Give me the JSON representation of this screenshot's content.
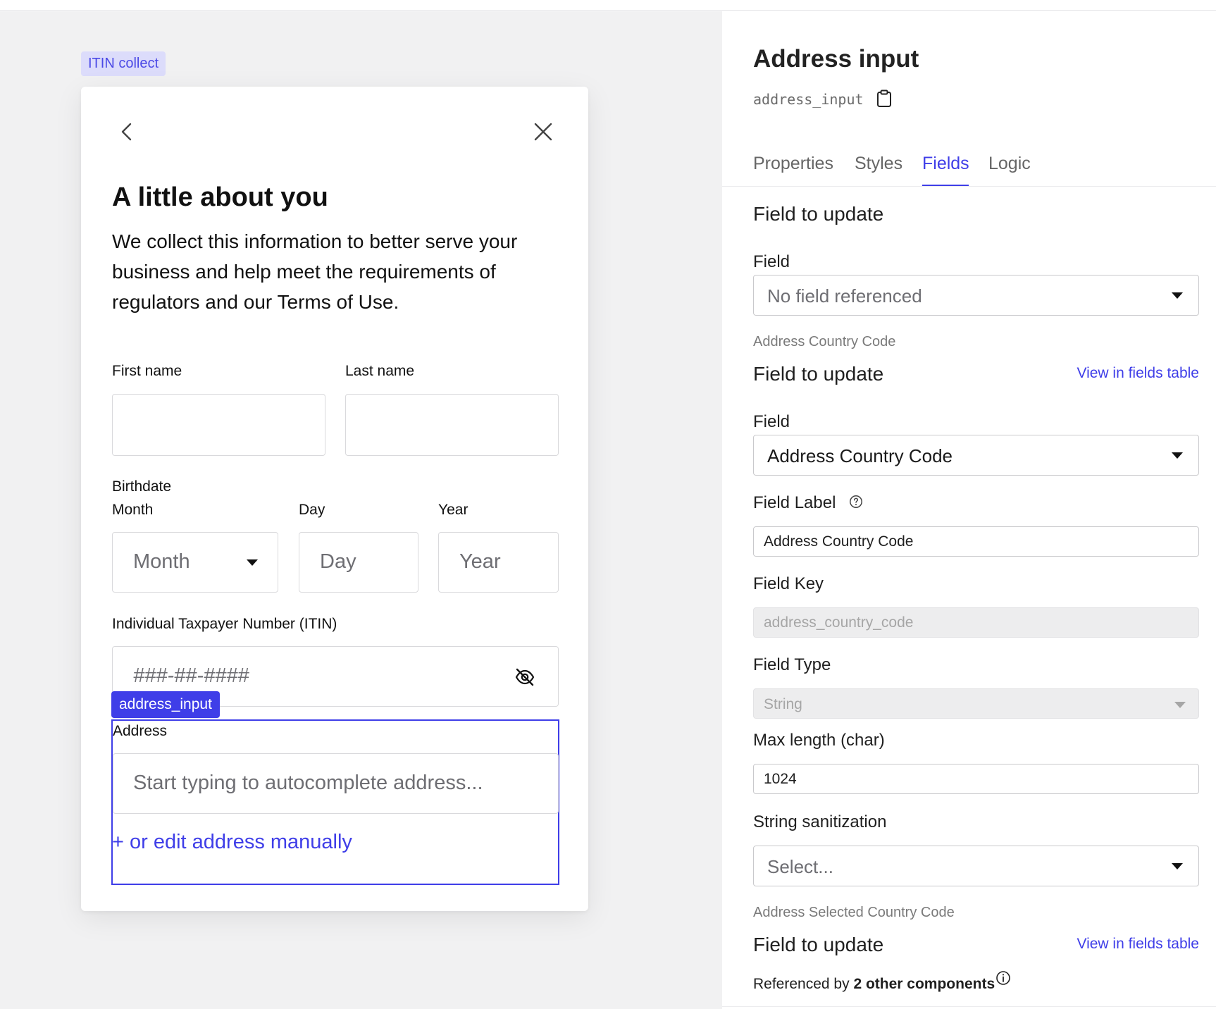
{
  "canvas": {
    "component_label": "ITIN collect",
    "form": {
      "title": "A little about you",
      "intro": "We collect this information to better serve your business and help meet the requirements of regulators and our Terms of Use.",
      "first_name_label": "First name",
      "last_name_label": "Last name",
      "birthdate_label": "Birthdate",
      "month_label": "Month",
      "day_label": "Day",
      "year_label": "Year",
      "month_placeholder": "Month",
      "day_placeholder": "Day",
      "year_placeholder": "Year",
      "itin_label": "Individual Taxpayer Number (ITIN)",
      "itin_placeholder": "###-##-####",
      "selected_tag": "address_input",
      "address_label": "Address",
      "address_placeholder": "Start typing to autocomplete address...",
      "address_manual_link": "+ or edit address manually"
    }
  },
  "panel": {
    "title": "Address input",
    "key": "address_input",
    "tabs": [
      {
        "label": "Properties",
        "active": false
      },
      {
        "label": "Styles",
        "active": false
      },
      {
        "label": "Fields",
        "active": true
      },
      {
        "label": "Logic",
        "active": false
      }
    ],
    "section1": {
      "heading": "Field to update",
      "field_label": "Field",
      "field_value": "No field referenced"
    },
    "section2": {
      "caption": "Address Country Code",
      "heading": "Field to update",
      "link": "View in fields table",
      "field_label": "Field",
      "field_value": "Address Country Code",
      "field_label_label": "Field Label",
      "field_label_value": "Address Country Code",
      "field_key_label": "Field Key",
      "field_key_value": "address_country_code",
      "field_type_label": "Field Type",
      "field_type_value": "String",
      "max_length_label": "Max length (char)",
      "max_length_value": "1024",
      "sanitization_label": "String sanitization",
      "sanitization_placeholder": "Select..."
    },
    "section3": {
      "caption": "Address Selected Country Code",
      "heading": "Field to update",
      "link": "View in fields table"
    },
    "referenced": {
      "prefix": "Referenced by",
      "count_text": "2 other components"
    }
  },
  "colors": {
    "accent": "#3f3ee8",
    "canvas_bg": "#f1f1f2",
    "label_chip_bg": "#dcdcfb"
  },
  "icons": [
    "chevron-left-icon",
    "close-icon",
    "chevron-down-icon",
    "eye-off-icon",
    "clipboard-icon",
    "help-circle-icon",
    "info-icon"
  ]
}
